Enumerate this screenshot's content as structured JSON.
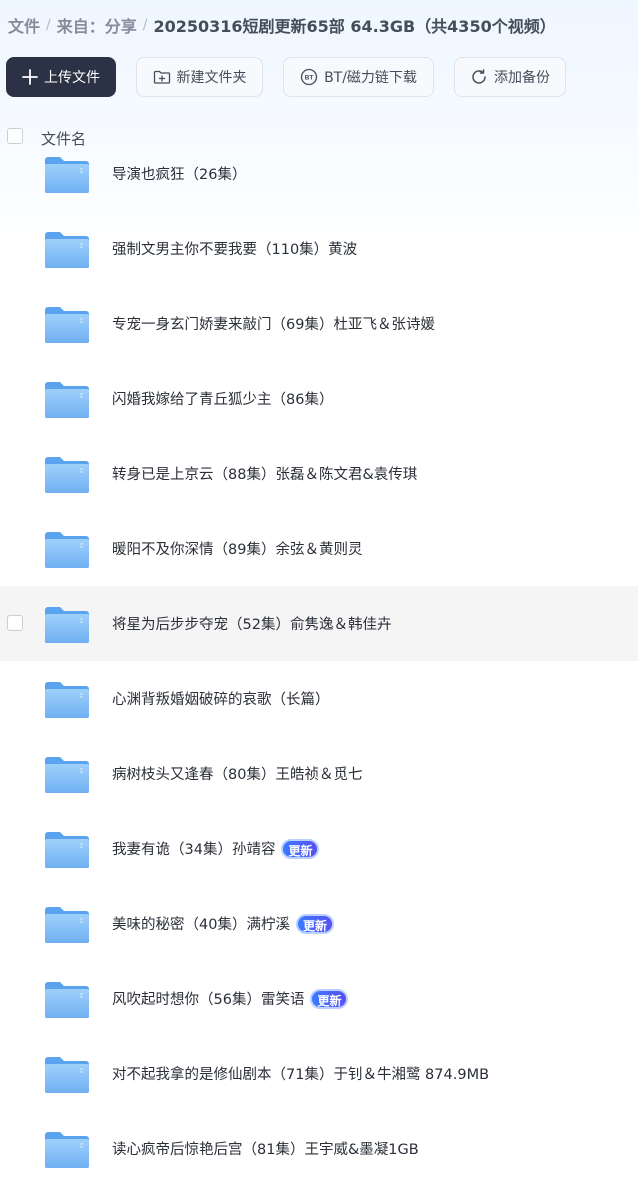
{
  "breadcrumb": {
    "items": [
      "文件",
      "来自：分享"
    ],
    "separator": "/",
    "current": "20250316短剧更新65部 64.3GB（共4350个视频）"
  },
  "toolbar": {
    "upload_label": "上传文件",
    "new_folder_label": "新建文件夹",
    "bt_label": "BT/磁力链下载",
    "backup_label": "添加备份"
  },
  "list": {
    "header_label": "文件名",
    "hover_row_index": 6,
    "rows": [
      {
        "name": "导演也疯狂（26集）",
        "badge": ""
      },
      {
        "name": "强制文男主你不要我要（110集）黄波",
        "badge": ""
      },
      {
        "name": "专宠一身玄门娇妻来敲门（69集）杜亚飞＆张诗媛",
        "badge": ""
      },
      {
        "name": "闪婚我嫁给了青丘狐少主（86集）",
        "badge": ""
      },
      {
        "name": "转身已是上京云（88集）张磊＆陈文君&袁传琪",
        "badge": ""
      },
      {
        "name": "暖阳不及你深情（89集）余弦＆黄则灵",
        "badge": ""
      },
      {
        "name": "将星为后步步夺宠（52集）俞隽逸＆韩佳卉",
        "badge": ""
      },
      {
        "name": "心渊背叛婚姻破碎的哀歌（长篇）",
        "badge": ""
      },
      {
        "name": "病树枝头又逢春（80集）王皓祯＆觅七",
        "badge": ""
      },
      {
        "name": "我妻有诡（34集）孙靖容",
        "badge": "更新"
      },
      {
        "name": "美味的秘密（40集）满柠溪",
        "badge": "更新"
      },
      {
        "name": "风吹起时想你（56集）雷笑语",
        "badge": "更新"
      },
      {
        "name": "对不起我拿的是修仙剧本（71集）于钊＆牛湘鹭 874.9MB",
        "badge": ""
      },
      {
        "name": "读心疯帝后惊艳后宫（81集）王宇威&墨凝1GB",
        "badge": ""
      }
    ]
  },
  "colors": {
    "primary_button": "#2b3246",
    "folder": "#7cb8f5",
    "badge": "#3a7bff",
    "hover_row": "#f5f5f6"
  }
}
